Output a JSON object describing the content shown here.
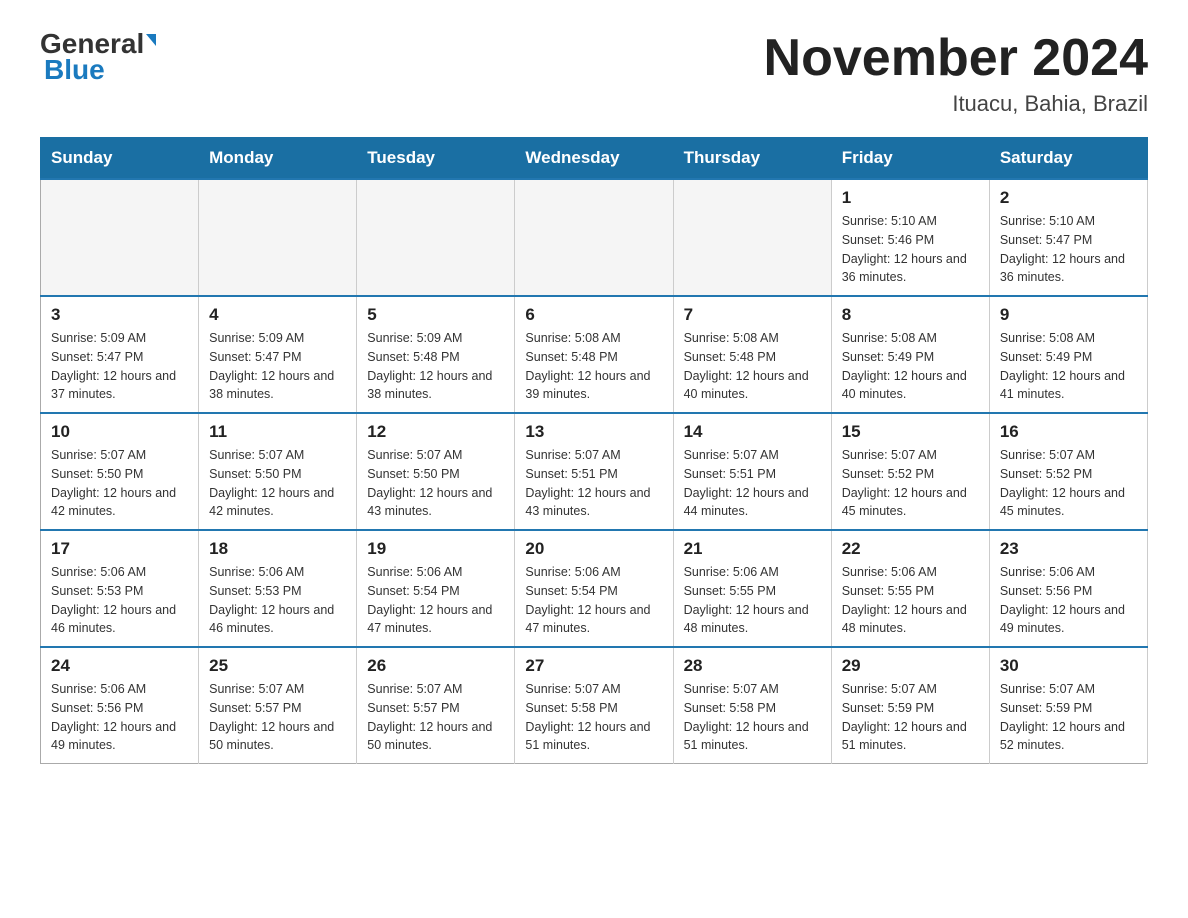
{
  "header": {
    "logo_general": "General",
    "logo_blue": "Blue",
    "month_title": "November 2024",
    "location": "Ituacu, Bahia, Brazil"
  },
  "weekdays": [
    "Sunday",
    "Monday",
    "Tuesday",
    "Wednesday",
    "Thursday",
    "Friday",
    "Saturday"
  ],
  "weeks": [
    [
      {
        "day": "",
        "info": ""
      },
      {
        "day": "",
        "info": ""
      },
      {
        "day": "",
        "info": ""
      },
      {
        "day": "",
        "info": ""
      },
      {
        "day": "",
        "info": ""
      },
      {
        "day": "1",
        "info": "Sunrise: 5:10 AM\nSunset: 5:46 PM\nDaylight: 12 hours and 36 minutes."
      },
      {
        "day": "2",
        "info": "Sunrise: 5:10 AM\nSunset: 5:47 PM\nDaylight: 12 hours and 36 minutes."
      }
    ],
    [
      {
        "day": "3",
        "info": "Sunrise: 5:09 AM\nSunset: 5:47 PM\nDaylight: 12 hours and 37 minutes."
      },
      {
        "day": "4",
        "info": "Sunrise: 5:09 AM\nSunset: 5:47 PM\nDaylight: 12 hours and 38 minutes."
      },
      {
        "day": "5",
        "info": "Sunrise: 5:09 AM\nSunset: 5:48 PM\nDaylight: 12 hours and 38 minutes."
      },
      {
        "day": "6",
        "info": "Sunrise: 5:08 AM\nSunset: 5:48 PM\nDaylight: 12 hours and 39 minutes."
      },
      {
        "day": "7",
        "info": "Sunrise: 5:08 AM\nSunset: 5:48 PM\nDaylight: 12 hours and 40 minutes."
      },
      {
        "day": "8",
        "info": "Sunrise: 5:08 AM\nSunset: 5:49 PM\nDaylight: 12 hours and 40 minutes."
      },
      {
        "day": "9",
        "info": "Sunrise: 5:08 AM\nSunset: 5:49 PM\nDaylight: 12 hours and 41 minutes."
      }
    ],
    [
      {
        "day": "10",
        "info": "Sunrise: 5:07 AM\nSunset: 5:50 PM\nDaylight: 12 hours and 42 minutes."
      },
      {
        "day": "11",
        "info": "Sunrise: 5:07 AM\nSunset: 5:50 PM\nDaylight: 12 hours and 42 minutes."
      },
      {
        "day": "12",
        "info": "Sunrise: 5:07 AM\nSunset: 5:50 PM\nDaylight: 12 hours and 43 minutes."
      },
      {
        "day": "13",
        "info": "Sunrise: 5:07 AM\nSunset: 5:51 PM\nDaylight: 12 hours and 43 minutes."
      },
      {
        "day": "14",
        "info": "Sunrise: 5:07 AM\nSunset: 5:51 PM\nDaylight: 12 hours and 44 minutes."
      },
      {
        "day": "15",
        "info": "Sunrise: 5:07 AM\nSunset: 5:52 PM\nDaylight: 12 hours and 45 minutes."
      },
      {
        "day": "16",
        "info": "Sunrise: 5:07 AM\nSunset: 5:52 PM\nDaylight: 12 hours and 45 minutes."
      }
    ],
    [
      {
        "day": "17",
        "info": "Sunrise: 5:06 AM\nSunset: 5:53 PM\nDaylight: 12 hours and 46 minutes."
      },
      {
        "day": "18",
        "info": "Sunrise: 5:06 AM\nSunset: 5:53 PM\nDaylight: 12 hours and 46 minutes."
      },
      {
        "day": "19",
        "info": "Sunrise: 5:06 AM\nSunset: 5:54 PM\nDaylight: 12 hours and 47 minutes."
      },
      {
        "day": "20",
        "info": "Sunrise: 5:06 AM\nSunset: 5:54 PM\nDaylight: 12 hours and 47 minutes."
      },
      {
        "day": "21",
        "info": "Sunrise: 5:06 AM\nSunset: 5:55 PM\nDaylight: 12 hours and 48 minutes."
      },
      {
        "day": "22",
        "info": "Sunrise: 5:06 AM\nSunset: 5:55 PM\nDaylight: 12 hours and 48 minutes."
      },
      {
        "day": "23",
        "info": "Sunrise: 5:06 AM\nSunset: 5:56 PM\nDaylight: 12 hours and 49 minutes."
      }
    ],
    [
      {
        "day": "24",
        "info": "Sunrise: 5:06 AM\nSunset: 5:56 PM\nDaylight: 12 hours and 49 minutes."
      },
      {
        "day": "25",
        "info": "Sunrise: 5:07 AM\nSunset: 5:57 PM\nDaylight: 12 hours and 50 minutes."
      },
      {
        "day": "26",
        "info": "Sunrise: 5:07 AM\nSunset: 5:57 PM\nDaylight: 12 hours and 50 minutes."
      },
      {
        "day": "27",
        "info": "Sunrise: 5:07 AM\nSunset: 5:58 PM\nDaylight: 12 hours and 51 minutes."
      },
      {
        "day": "28",
        "info": "Sunrise: 5:07 AM\nSunset: 5:58 PM\nDaylight: 12 hours and 51 minutes."
      },
      {
        "day": "29",
        "info": "Sunrise: 5:07 AM\nSunset: 5:59 PM\nDaylight: 12 hours and 51 minutes."
      },
      {
        "day": "30",
        "info": "Sunrise: 5:07 AM\nSunset: 5:59 PM\nDaylight: 12 hours and 52 minutes."
      }
    ]
  ]
}
